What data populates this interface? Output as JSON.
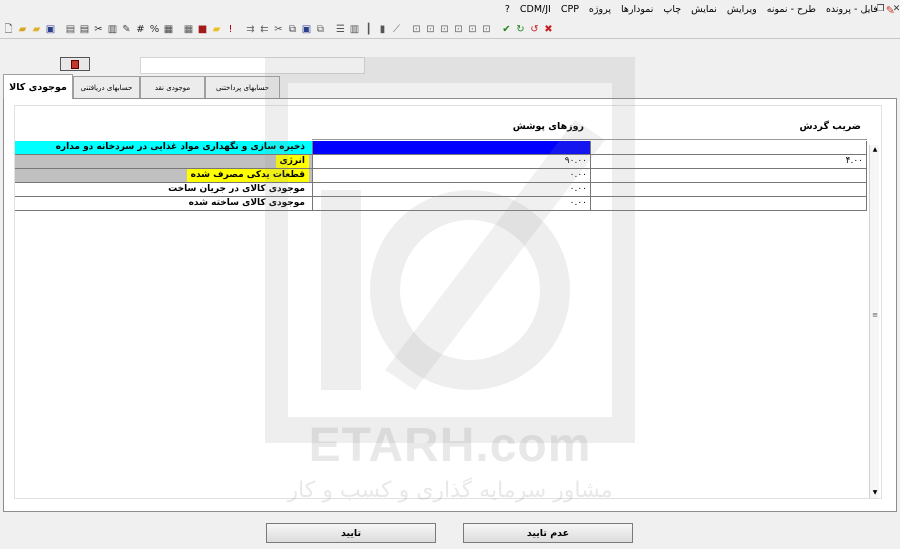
{
  "menu": {
    "items": [
      "فایل - پرونده",
      "طرح - نمونه",
      "ویرایش",
      "نمایش",
      "چاپ",
      "نمودارها",
      "پروژه",
      "CPP",
      "CDM/JI",
      "?"
    ]
  },
  "window_buttons": {
    "minimize": "_",
    "restore": "❐",
    "close": "✕"
  },
  "toolbar": {
    "icons": [
      {
        "name": "new-file-icon",
        "glyph": "🗋",
        "color": "#444"
      },
      {
        "name": "open-folder-icon",
        "glyph": "▰",
        "color": "#d8a520"
      },
      {
        "name": "open-alt-icon",
        "glyph": "▰",
        "color": "#e0b030"
      },
      {
        "name": "save-icon",
        "glyph": "▣",
        "color": "#2b3f8c"
      },
      {
        "sep": true
      },
      {
        "name": "print-icon",
        "glyph": "▤",
        "color": "#555"
      },
      {
        "name": "print-preview-icon",
        "glyph": "▤",
        "color": "#444"
      },
      {
        "name": "scissors-icon",
        "glyph": "✂",
        "color": "#333"
      },
      {
        "name": "chart-icon",
        "glyph": "▥",
        "color": "#444"
      },
      {
        "name": "tools-icon",
        "glyph": "✎",
        "color": "#444"
      },
      {
        "name": "grid-hash-icon",
        "glyph": "#",
        "color": "#222"
      },
      {
        "name": "percent-icon",
        "glyph": "%",
        "color": "#333"
      },
      {
        "name": "bars-icon",
        "glyph": "▦",
        "color": "#444"
      },
      {
        "sep": true
      },
      {
        "name": "table-icon",
        "glyph": "▦",
        "color": "#555"
      },
      {
        "name": "book-icon",
        "glyph": "■",
        "color": "#a31a1a"
      },
      {
        "name": "note-icon",
        "glyph": "▰",
        "color": "#e8c020"
      },
      {
        "name": "alert-icon",
        "glyph": "!",
        "color": "#b00"
      },
      {
        "sep": true
      },
      {
        "name": "flow-in-icon",
        "glyph": "⇉",
        "color": "#666"
      },
      {
        "name": "flow-out-icon",
        "glyph": "⇇",
        "color": "#666"
      },
      {
        "name": "cut-icon",
        "glyph": "✂",
        "color": "#555"
      },
      {
        "name": "copy-icon",
        "glyph": "⧉",
        "color": "#555"
      },
      {
        "name": "paste-icon",
        "glyph": "▣",
        "color": "#2b3f8c"
      },
      {
        "name": "duplicate-icon",
        "glyph": "⧉",
        "color": "#666"
      },
      {
        "sep": true
      },
      {
        "name": "columns-icon",
        "glyph": "☰",
        "color": "#555"
      },
      {
        "name": "rows-icon",
        "glyph": "▥",
        "color": "#555"
      },
      {
        "name": "bar-chart-icon",
        "glyph": "┃",
        "color": "#555"
      },
      {
        "name": "histogram-icon",
        "glyph": "▮",
        "color": "#555"
      },
      {
        "name": "line-chart-icon",
        "glyph": "⟋",
        "color": "#666"
      },
      {
        "sep": true
      },
      {
        "name": "node-a-icon",
        "glyph": "⊡",
        "color": "#666"
      },
      {
        "name": "node-b-icon",
        "glyph": "⊡",
        "color": "#666"
      },
      {
        "name": "node-c-icon",
        "glyph": "⊡",
        "color": "#666"
      },
      {
        "name": "node-d-icon",
        "glyph": "⊡",
        "color": "#666"
      },
      {
        "name": "node-e-icon",
        "glyph": "⊡",
        "color": "#666"
      },
      {
        "name": "node-f-icon",
        "glyph": "⊡",
        "color": "#666"
      },
      {
        "sep": true
      },
      {
        "name": "check-icon",
        "glyph": "✔",
        "color": "#1a8a1a"
      },
      {
        "name": "refresh-icon",
        "glyph": "↻",
        "color": "#1a8a1a"
      },
      {
        "name": "undo-icon",
        "glyph": "↺",
        "color": "#c82020"
      },
      {
        "name": "reject-icon",
        "glyph": "✖",
        "color": "#c82020"
      }
    ]
  },
  "tabs": [
    "موجودی کالا",
    "حسابهای دریافتنی",
    "موجودی نقد",
    "حسابهای پرداختنی"
  ],
  "grid": {
    "columns": [
      "روزهای پوشش",
      "ضریب گردش"
    ],
    "rows": [
      {
        "label": "ذخیره سازی و نگهداری مواد غذایی در سردخانه دو مداره",
        "bg": "#00ffff",
        "label_bg": "#00ffff",
        "v1": "",
        "v2": "",
        "v1_bg": "#0000ff"
      },
      {
        "label": "انرژی",
        "bg": "#c0c0c0",
        "label_bg": "#ffff00",
        "v1": "۹۰.۰۰",
        "v2": "۴.۰۰"
      },
      {
        "label": "قطعات یدکی مصرف شده",
        "bg": "#c0c0c0",
        "label_bg": "#ffff00",
        "v1": "۰.۰۰",
        "v2": ""
      },
      {
        "label": "موجودی کالای در جریان ساخت",
        "bg": "#ffffff",
        "label_bg": "",
        "v1": "۰.۰۰",
        "v2": ""
      },
      {
        "label": "موجودی کالای ساخته شده",
        "bg": "#ffffff",
        "label_bg": "",
        "v1": "۰.۰۰",
        "v2": ""
      }
    ]
  },
  "watermark": {
    "title": "ETARH.com",
    "subtitle": "مشاور سرمایه گذاری و کسب و کار"
  },
  "buttons": {
    "confirm": "تایید",
    "reject": "عدم تایید"
  },
  "colors": {
    "accent_cyan": "#00ffff",
    "highlight_yellow": "#ffff00",
    "selected_blue": "#0000ff",
    "gray_fill": "#c0c0c0"
  }
}
